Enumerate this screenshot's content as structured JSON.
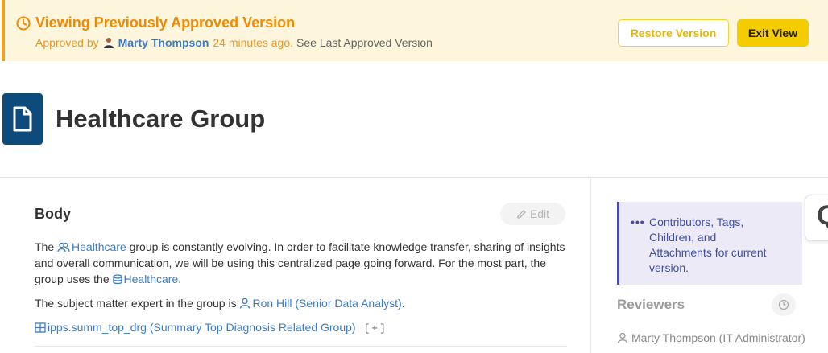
{
  "banner": {
    "title": "Viewing Previously Approved Version",
    "approved_by_prefix": "Approved by",
    "approver": "Marty Thompson",
    "time_ago": "24 minutes ago.",
    "see_last": "See Last Approved Version",
    "restore_label": "Restore Version",
    "exit_label": "Exit View",
    "icon": "clock-icon",
    "accent_color": "#f08a00"
  },
  "header": {
    "title": "Healthcare Group",
    "icon": "document-icon"
  },
  "body": {
    "heading": "Body",
    "edit_label": "Edit",
    "p1_a": "The",
    "p1_group_link": "Healthcare",
    "p1_b": "group is constantly evolving. In order to facilitate knowledge transfer, sharing of insights and overall communication, we will be using this centralized page going forward. For the most part, the group uses the",
    "p1_db_link": "Healthcare",
    "p1_c": ".",
    "p2_a": "The subject matter expert in the group is",
    "p2_link": "Ron Hill (Senior Data Analyst)",
    "p2_b": ".",
    "p3_link": "ipps.summ_top_drg (Summary Top Diagnosis Related Group)",
    "p3_expand": "[+]"
  },
  "sidebar": {
    "info_dots": "•••",
    "info_text": "Contributors, Tags, Children, and Attachments for current version.",
    "reviewers_heading": "Reviewers",
    "reviewer": "Marty Thompson (IT Administrator)",
    "float_tab_glyph": "Q"
  }
}
